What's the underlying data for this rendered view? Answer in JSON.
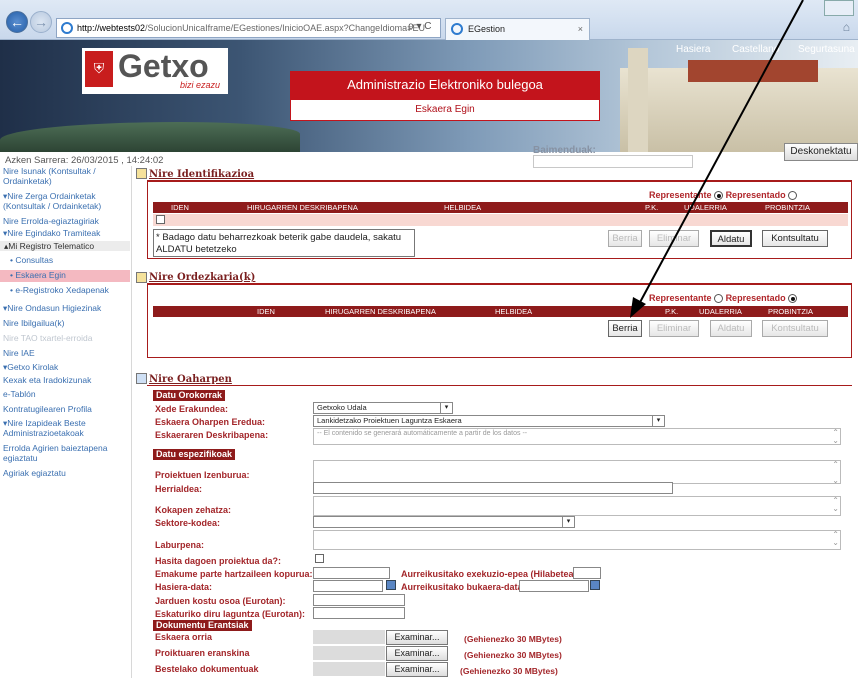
{
  "browser": {
    "url_host": "http://webtests02",
    "url_path": "/SolucionUnicaIframe/EGestiones/InicioOAE.aspx?ChangeIdioma=EU",
    "addr_controls": "ρ ▾ C",
    "tab_title": "EGestion",
    "tab_close": "×",
    "back_glyph": "←",
    "forward_glyph": "→",
    "home_glyph": "⌂"
  },
  "header": {
    "logo_name": "Getxo",
    "logo_tagline": "bizi ezazu",
    "nav": [
      "Hasiera",
      "Castellano",
      "Segurtasuna"
    ],
    "title": "Administrazio Elektroniko bulegoa",
    "subtitle": "Eskaera Egin",
    "baimenduak_label": "Baimenduak:",
    "disconnect_label": "Deskonektatu",
    "last_login": "Azken Sarrera: 26/03/2015 , 14:24:02"
  },
  "sidebar": {
    "items": [
      {
        "label": "Nire Isunak (Kontsultak / Ordainketak)"
      },
      {
        "label": "▾Nire Zerga Ordainketak (Kontsultak / Ordainketak)"
      },
      {
        "label": "Nire Errolda-egiaztagiriak"
      },
      {
        "label": "▾Nire Egindako Tramiteak"
      },
      {
        "label": "▴Mi Registro Telematico"
      },
      {
        "label": "• Consultas"
      },
      {
        "label": "• Eskaera Egin"
      },
      {
        "label": "• e-Registroko Xedapenak"
      },
      {
        "label": "▾Nire Ondasun Higiezinak"
      },
      {
        "label": "Nire Ibilgailua(k)"
      },
      {
        "label": "Nire TAO txartel-erroida"
      },
      {
        "label": "Nire IAE"
      },
      {
        "label": "▾Getxo Kirolak"
      },
      {
        "label": "Kexak eta Iradokizunak"
      },
      {
        "label": "e-Tablón"
      },
      {
        "label": "Kontratugilearen Profila"
      },
      {
        "label": "▾Nire Izapideak Beste Administrazioetakoak"
      },
      {
        "label": "Errolda Agirien baieztapena egiaztatu"
      },
      {
        "label": "Agiriak egiaztatu"
      }
    ]
  },
  "identification": {
    "title": "Nire Identifikazioa",
    "representante": "Representante",
    "representado": "Representado",
    "columns": [
      "IDEN",
      "HIRUGARREN DESKRIBAPENA",
      "HELBIDEA",
      "P.K.",
      "UDALERRIA",
      "PROBINTZIA"
    ],
    "note": "* Badago datu beharrezkoak beterik gabe daudela, sakatu ALDATU betetzeko",
    "buttons": [
      "Berria",
      "Eliminar",
      "Aldatu",
      "Kontsultatu"
    ]
  },
  "representative": {
    "title": "Nire Ordezkaria(k)",
    "representante": "Representante",
    "representado": "Representado",
    "columns": [
      "IDEN",
      "HIRUGARREN DESKRIBAPENA",
      "HELBIDEA",
      "P.K.",
      "UDALERRIA",
      "PROBINTZIA"
    ],
    "buttons": [
      "Berria",
      "Eliminar",
      "Aldatu",
      "Kontsultatu"
    ]
  },
  "requests": {
    "title": "Nire Oaharpen",
    "general_head": "Datu Orokorrak",
    "receiving_label": "Xede Erakundea:",
    "receiving_value": "Getxoko Udala",
    "model_label": "Eskaera Oharpen Eredua:",
    "model_value": "Lankidetzako Proiektuen Laguntza Eskaera",
    "desc_label": "Eskaeraren Deskribapena:",
    "desc_placeholder": "-- El contenido se generará automáticamente a partir de los datos --",
    "specific_head": "Datu espezifikoak",
    "project_title_label": "Proiektuen Izenburua:",
    "herrialdea_label": "Herrialdea:",
    "kokapen_label": "Kokapen zehatza:",
    "sektore_label": "Sektore-kodea:",
    "laburpena_label": "Laburpena:",
    "hasita_label": "Hasita dagoen proiektua da?:",
    "emakume_label": "Emakume parte hartzaileen kopurua:",
    "exec_label": "Aurreikusitako exekuzio-epea (Hilabeteak):",
    "hasiera_label": "Hasiera-data:",
    "bukaera_label": "Aurreikusitako bukaera-data:",
    "jarduen_label": "Jarduen kostu osoa (Eurotan):",
    "eskatutako_label": "Eskaturiko diru laguntza (Eurotan):",
    "docs_head": "Dokumentu Erantsiak",
    "docs": [
      {
        "label": "Eskaera orria",
        "button": "Examinar...",
        "note": "(Gehienezko 30 MBytes)"
      },
      {
        "label": "Proiktuaren eranskina",
        "button": "Examinar...",
        "note": "(Gehienezko 30 MBytes)"
      },
      {
        "label": "Bestelako dokumentuak",
        "button": "Examinar...",
        "note": "(Gehienezko 30 MBytes)"
      }
    ]
  }
}
